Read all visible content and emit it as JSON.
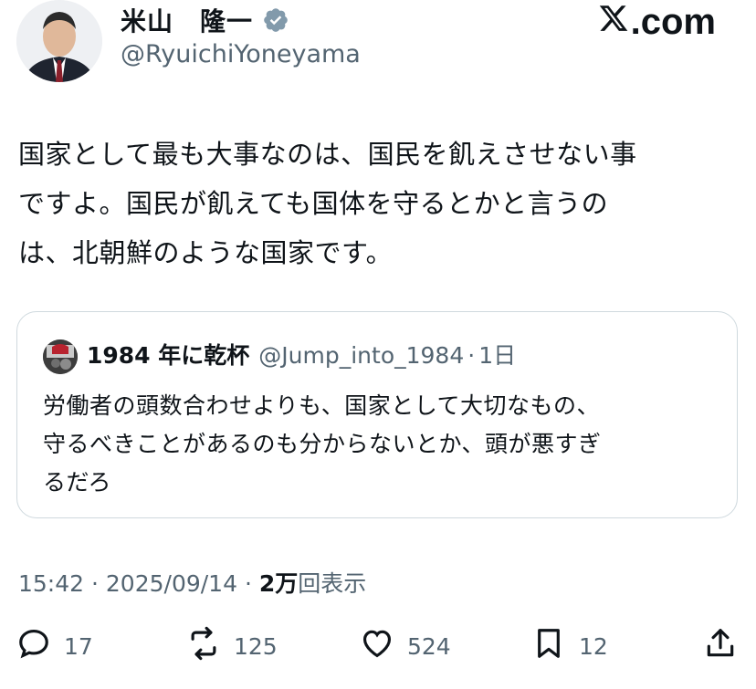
{
  "author": {
    "display_name": "米山　隆一",
    "handle": "@RyuichiYoneyama",
    "avatar_icon": "profile-photo",
    "verified_icon": "verified-badge-icon"
  },
  "brand": {
    "logo_text": ".com",
    "logo_icon": "x-logo-icon"
  },
  "tweet": {
    "lines": [
      "国家として最も大事なのは、国民を飢えさせない事",
      "ですよ。国民が飢えても国体を守るとかと言うの",
      "は、北朝鮮のような国家です。"
    ]
  },
  "quote": {
    "name": "1984 年に乾杯",
    "handle": "@Jump_into_1984",
    "dot": "·",
    "time": "1日",
    "lines": [
      "労働者の頭数合わせよりも、国家として大切なもの、",
      "守るべきことがあるのも分からないとか、頭が悪すぎ",
      "るだろ"
    ]
  },
  "meta": {
    "time": "15:42",
    "sep1": "·",
    "date": "2025/09/14",
    "sep2": "·",
    "views_count": "2万",
    "views_label": "回表示"
  },
  "actions": {
    "reply_count": "17",
    "retweet_count": "125",
    "like_count": "524",
    "bookmark_count": "12"
  },
  "colors": {
    "text": "#0f1419",
    "secondary": "#536471",
    "border": "#cfd9de",
    "verified_badge": "#829aab"
  }
}
